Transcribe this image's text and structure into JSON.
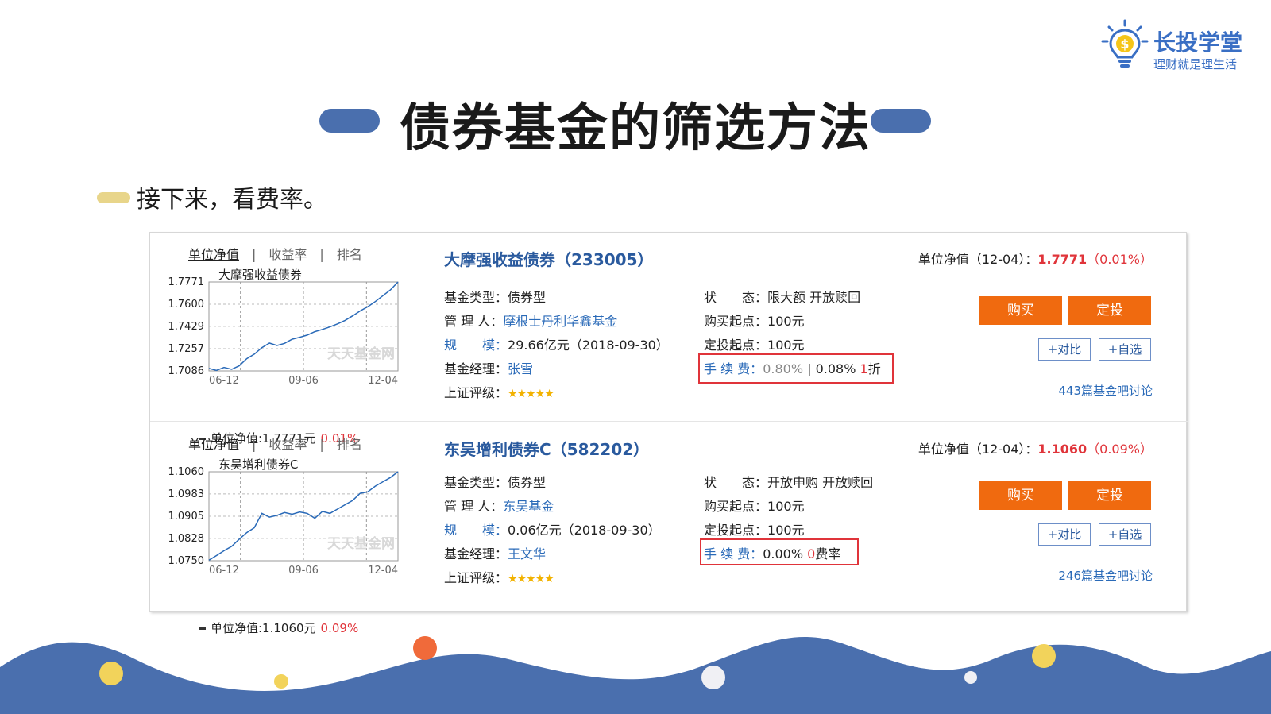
{
  "logo": {
    "name": "长投学堂",
    "slogan": "理财就是理生活",
    "icon": "lightbulb-dollar-icon",
    "color": "#3a6fc4"
  },
  "slide": {
    "title": "债券基金的筛选方法",
    "subtitle": "接下来，看费率。",
    "accent_pill": "#4a6fae",
    "bullet_color": "#e8d58a"
  },
  "tabs": [
    "单位净值",
    "收益率",
    "排名"
  ],
  "chart_data": [
    {
      "type": "line",
      "title": "大摩强收益债券",
      "x_ticks": [
        "06-12",
        "09-06",
        "12-04"
      ],
      "y_ticks": [
        1.7771,
        1.76,
        1.7429,
        1.7257,
        1.7086
      ],
      "ylim": [
        1.7086,
        1.7771
      ],
      "values": [
        1.7105,
        1.709,
        1.7112,
        1.7098,
        1.7125,
        1.718,
        1.7215,
        1.7265,
        1.73,
        1.7282,
        1.7298,
        1.733,
        1.7345,
        1.7362,
        1.7388,
        1.7405,
        1.7425,
        1.7448,
        1.7475,
        1.751,
        1.7548,
        1.758,
        1.762,
        1.7665,
        1.771,
        1.7771
      ],
      "watermark": "天天基金网",
      "grid": true
    },
    {
      "type": "line",
      "title": "东吴增利债券C",
      "x_ticks": [
        "06-12",
        "09-06",
        "12-04"
      ],
      "y_ticks": [
        1.106,
        1.0983,
        1.0905,
        1.0828,
        1.075
      ],
      "ylim": [
        1.075,
        1.106
      ],
      "values": [
        1.0752,
        1.0768,
        1.0785,
        1.08,
        1.0825,
        1.0848,
        1.0865,
        1.0915,
        1.0902,
        1.0908,
        1.0918,
        1.0912,
        1.092,
        1.0915,
        1.0898,
        1.0922,
        1.0915,
        1.093,
        1.0945,
        1.096,
        1.0985,
        1.099,
        1.101,
        1.1025,
        1.104,
        1.106
      ],
      "watermark": "天天基金网",
      "grid": true
    }
  ],
  "funds": [
    {
      "name": "大摩强收益债券（233005）",
      "chart_name": "大摩强收益债券",
      "nav_foot_label": "单位净值:1.7771元",
      "nav_foot_change": "0.01%",
      "nav_label": "单位净值（12-04）：",
      "nav_value": "1.7771",
      "nav_change": "（0.01%）",
      "type_label": "基金类型：",
      "type_value": "债券型",
      "manager_label": "管 理 人：",
      "manager_value": "摩根士丹利华鑫基金",
      "scale_label": "规　　模：",
      "scale_value": "29.66亿元（2018-09-30）",
      "fm_label": "基金经理：",
      "fm_value": "张雪",
      "rating_label": "上证评级：",
      "rating_stars": 5,
      "status_label": "状　　态：",
      "status_value": "限大额 开放赎回",
      "buy_min_label": "购买起点：",
      "buy_min_value": "100元",
      "sip_min_label": "定投起点：",
      "sip_min_value": "100元",
      "fee_label": "手 续 费：",
      "fee_original": "0.80%",
      "fee_sep": "|",
      "fee_current": "0.08%",
      "fee_discount_num": "1",
      "fee_discount_text": "折",
      "buy_btn": "购买",
      "sip_btn": "定投",
      "compare_btn": "+对比",
      "watch_btn": "+自选",
      "discuss": "443篇基金吧讨论"
    },
    {
      "name": "东吴增利债券C（582202）",
      "chart_name": "东吴增利债券C",
      "nav_foot_label": "单位净值:1.1060元",
      "nav_foot_change": "0.09%",
      "nav_label": "单位净值（12-04）：",
      "nav_value": "1.1060",
      "nav_change": "（0.09%）",
      "type_label": "基金类型：",
      "type_value": "债券型",
      "manager_label": "管 理 人：",
      "manager_value": "东吴基金",
      "scale_label": "规　　模：",
      "scale_value": "0.06亿元（2018-09-30）",
      "fm_label": "基金经理：",
      "fm_value": "王文华",
      "rating_label": "上证评级：",
      "rating_stars": 5,
      "status_label": "状　　态：",
      "status_value": "开放申购 开放赎回",
      "buy_min_label": "购买起点：",
      "buy_min_value": "100元",
      "sip_min_label": "定投起点：",
      "sip_min_value": "100元",
      "fee_label": "手 续 费：",
      "fee_current": "0.00%",
      "fee_discount_num": "0",
      "fee_discount_text": "费率",
      "buy_btn": "购买",
      "sip_btn": "定投",
      "compare_btn": "+对比",
      "watch_btn": "+自选",
      "discuss": "246篇基金吧讨论"
    }
  ],
  "colors": {
    "orange_button": "#f06a0f",
    "link_blue": "#2a6ab8",
    "red": "#e0343a",
    "wave_blue": "#4a6fae"
  }
}
